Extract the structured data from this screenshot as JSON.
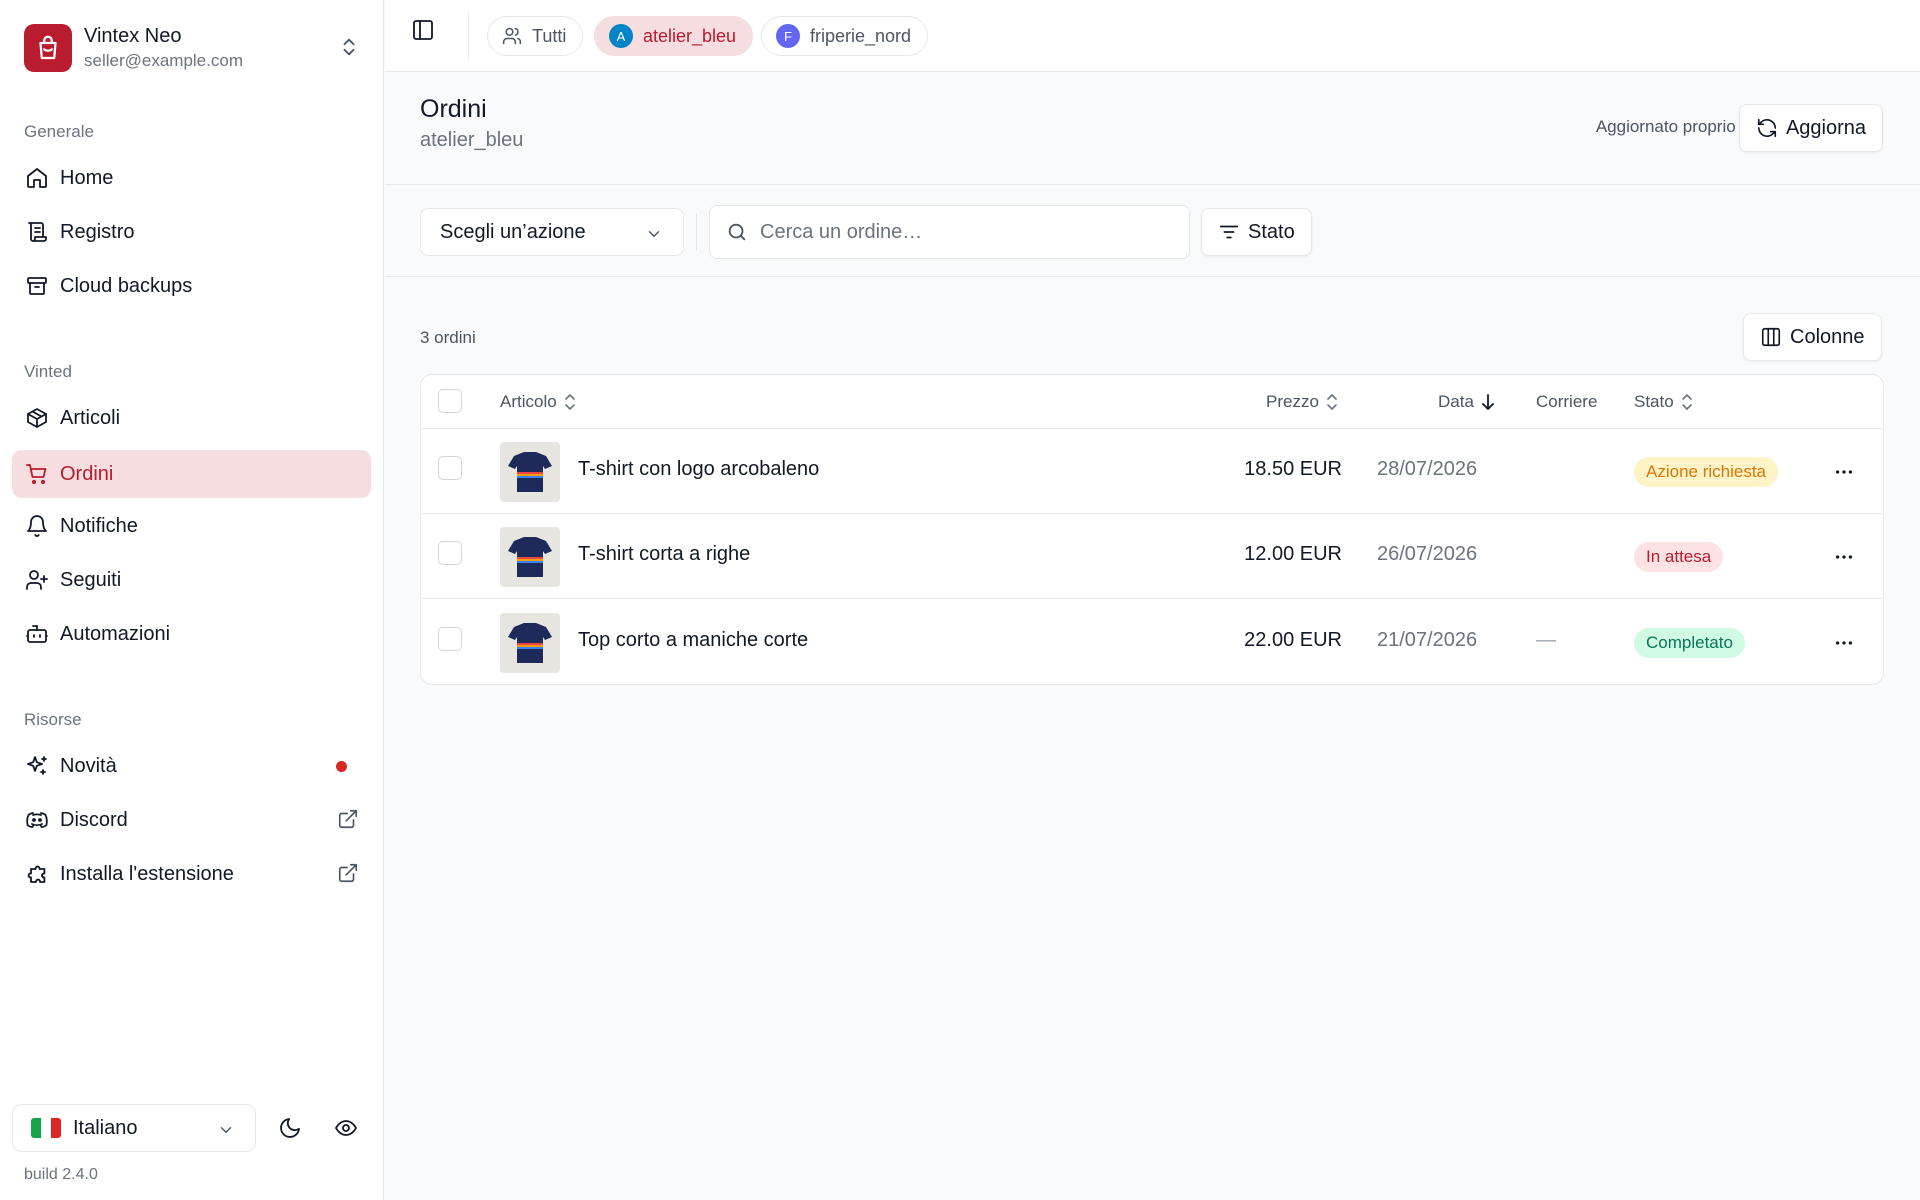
{
  "account": {
    "name": "Vintex Neo",
    "email": "seller@example.com"
  },
  "sidebar": {
    "sections": [
      {
        "label": "Generale",
        "items": [
          {
            "label": "Home",
            "icon": "home-icon"
          },
          {
            "label": "Registro",
            "icon": "scroll-icon"
          },
          {
            "label": "Cloud backups",
            "icon": "archive-icon"
          }
        ]
      },
      {
        "label": "Vinted",
        "items": [
          {
            "label": "Articoli",
            "icon": "package-icon"
          },
          {
            "label": "Ordini",
            "icon": "cart-icon",
            "active": true
          },
          {
            "label": "Notifiche",
            "icon": "bell-icon"
          },
          {
            "label": "Seguiti",
            "icon": "user-plus-icon"
          },
          {
            "label": "Automazioni",
            "icon": "bot-icon"
          }
        ]
      },
      {
        "label": "Risorse",
        "items": [
          {
            "label": "Novità",
            "icon": "sparkles-icon"
          },
          {
            "label": "Discord",
            "icon": "discord-icon"
          },
          {
            "label": "Installa l'estensione",
            "icon": "puzzle-icon"
          }
        ]
      }
    ],
    "language": "Italiano",
    "build": "build 2.4.0"
  },
  "topbar": {
    "chips": [
      {
        "label": "Tutti",
        "icon": "users-icon"
      },
      {
        "label": "atelier_bleu",
        "avatar": "A",
        "avatar_color": "#0284c7",
        "active": true
      },
      {
        "label": "friperie_nord",
        "avatar": "F",
        "avatar_color": "#6366f1"
      }
    ]
  },
  "header": {
    "title": "Ordini",
    "subtitle": "atelier_bleu",
    "updated": "Aggiornato proprio ora",
    "refresh_label": "Aggiorna"
  },
  "toolbar": {
    "action_placeholder": "Scegli un’azione",
    "search_placeholder": "Cerca un ordine…",
    "status_filter": "Stato"
  },
  "table": {
    "count": "3 ordini",
    "columns_button": "Colonne",
    "headers": {
      "article": "Articolo",
      "price": "Prezzo",
      "date": "Data",
      "carrier": "Corriere",
      "status": "Stato"
    },
    "rows": [
      {
        "title": "T-shirt con logo arcobaleno",
        "price": "18.50 EUR",
        "date": "28/07/2026",
        "carrier": "",
        "status": "Azione richiesta",
        "status_bg": "#fef3c7",
        "status_fg": "#d97706"
      },
      {
        "title": "T-shirt corta a righe",
        "price": "12.00 EUR",
        "date": "26/07/2026",
        "carrier": "",
        "status": "In attesa",
        "status_bg": "#fde2e4",
        "status_fg": "#b91c2c"
      },
      {
        "title": "Top corto a maniche corte",
        "price": "22.00 EUR",
        "date": "21/07/2026",
        "carrier": "—",
        "status": "Completato",
        "status_bg": "#d1fae5",
        "status_fg": "#047857"
      }
    ]
  },
  "colors": {
    "brand": "#b91c2c",
    "active_bg": "#f5dde0"
  }
}
